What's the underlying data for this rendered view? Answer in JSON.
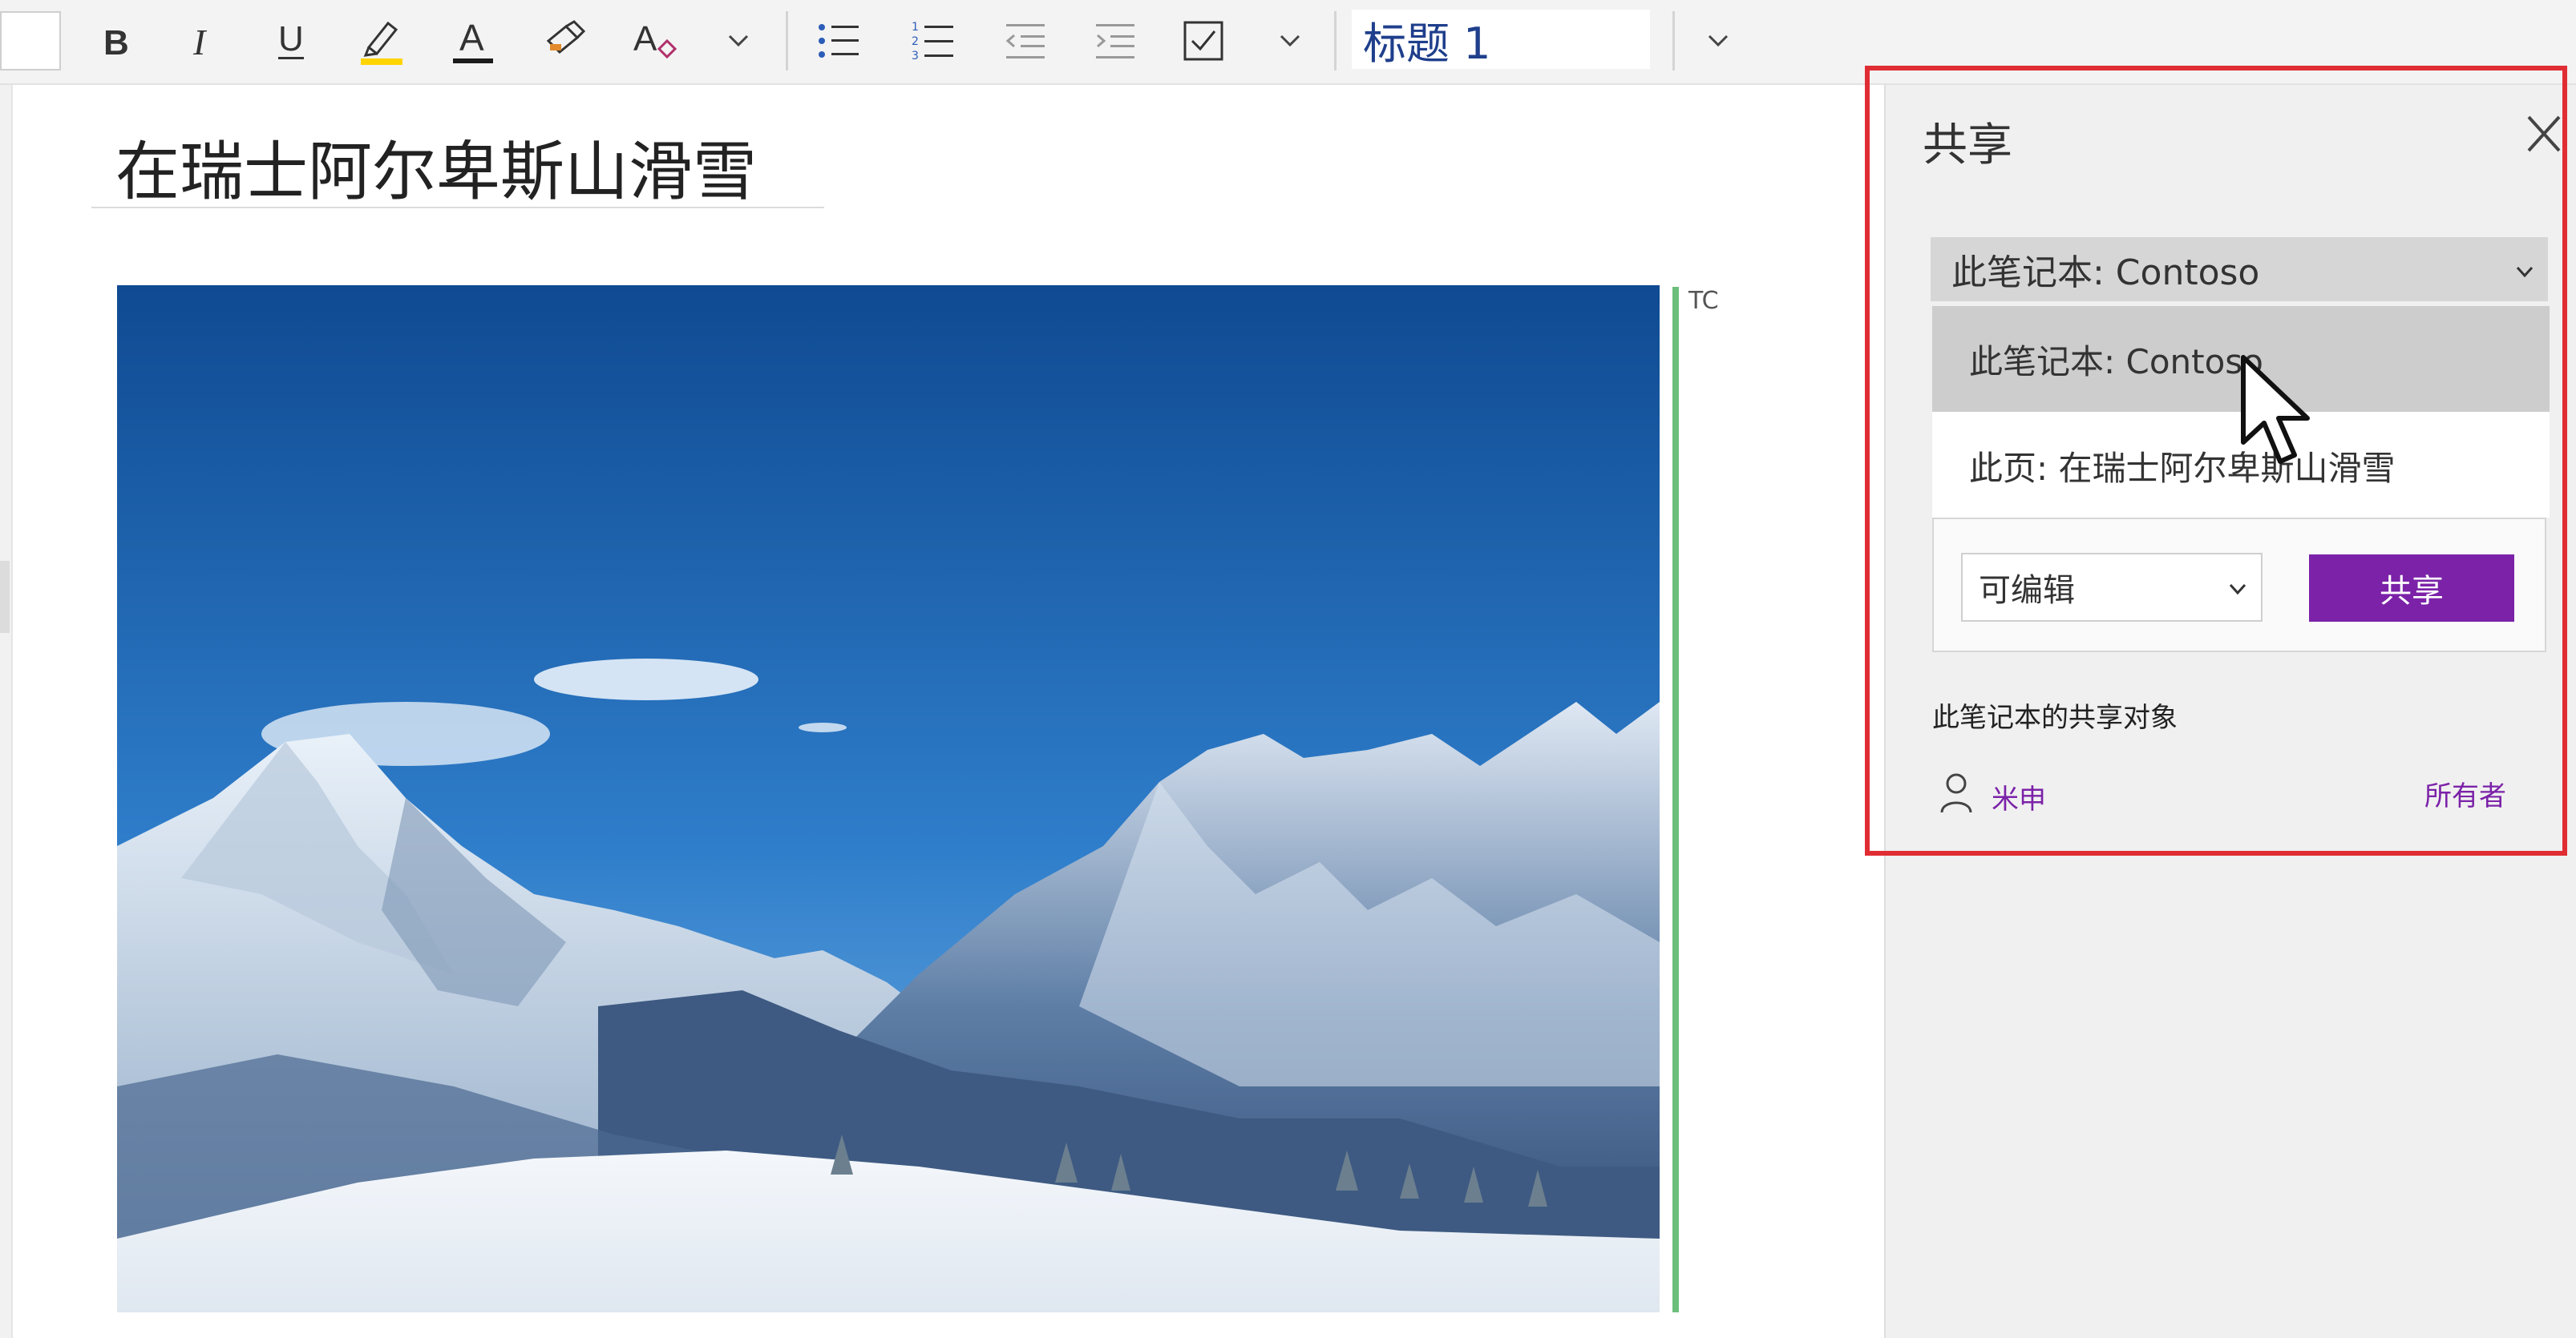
{
  "toolbar": {
    "style_value": "标题 1",
    "icons": [
      "bold-icon",
      "italic-icon",
      "underline-icon",
      "highlighter-icon",
      "font-color-icon",
      "format-painter-icon",
      "clear-formatting-icon",
      "chevron-down-icon",
      "bullet-list-icon",
      "numbered-list-icon",
      "outdent-icon",
      "indent-icon",
      "todo-checkbox-icon",
      "chevron-down-icon",
      "chevron-down-icon"
    ],
    "highlight_color": "#ffd400",
    "font_color": "#1a1a1a"
  },
  "page": {
    "title": "在瑞士阿尔卑斯山滑雪",
    "image_alt": "snowy-alps-photo",
    "author_initials": "TC",
    "author_bar_color": "#6cbf7b"
  },
  "share_panel": {
    "title": "共享",
    "scope_selected": "此笔记本: Contoso",
    "scope_options": [
      "此笔记本: Contoso",
      "此页: 在瑞士阿尔卑斯山滑雪"
    ],
    "permission_selected": "可编辑",
    "share_button_label": "共享",
    "shared_with_heading": "此笔记本的共享对象",
    "shared_people": [
      {
        "name": "米申",
        "role": "所有者"
      }
    ],
    "accent_color": "#7b22a8",
    "highlight_box_color": "#e02d34"
  }
}
